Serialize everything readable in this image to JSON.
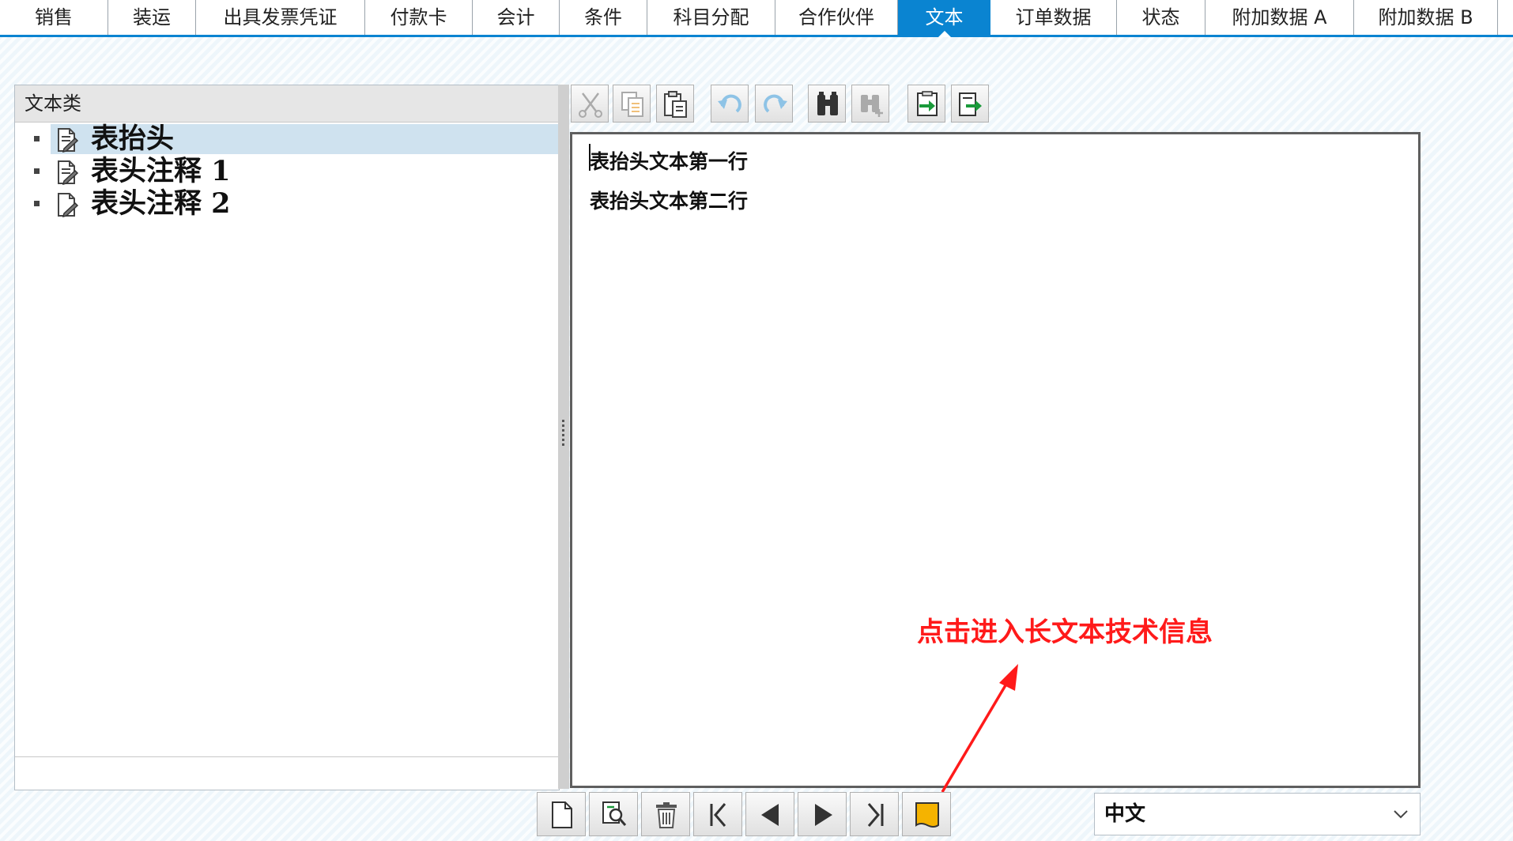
{
  "tabs": [
    {
      "label": "销售",
      "active": false
    },
    {
      "label": "装运",
      "active": false
    },
    {
      "label": "出具发票凭证",
      "active": false
    },
    {
      "label": "付款卡",
      "active": false
    },
    {
      "label": "会计",
      "active": false
    },
    {
      "label": "条件",
      "active": false
    },
    {
      "label": "科目分配",
      "active": false
    },
    {
      "label": "合作伙伴",
      "active": false
    },
    {
      "label": "文本",
      "active": true
    },
    {
      "label": "订单数据",
      "active": false
    },
    {
      "label": "状态",
      "active": false
    },
    {
      "label": "附加数据 A",
      "active": false
    },
    {
      "label": "附加数据 B",
      "active": false
    }
  ],
  "left_panel": {
    "header": "文本类",
    "items": [
      {
        "label": "表抬头",
        "selected": true,
        "icon": "document-edit-icon"
      },
      {
        "label": "表头注释 1",
        "selected": false,
        "icon": "document-edit-icon"
      },
      {
        "label": "表头注释 2",
        "selected": false,
        "icon": "document-edit-icon"
      }
    ]
  },
  "toolbar": {
    "buttons": [
      {
        "icon": "cut-icon",
        "enabled": false
      },
      {
        "icon": "copy-icon",
        "enabled": false
      },
      {
        "icon": "paste-icon",
        "enabled": true
      },
      {
        "icon": "undo-icon",
        "enabled": false
      },
      {
        "icon": "redo-icon",
        "enabled": false
      },
      {
        "icon": "find-icon",
        "enabled": true
      },
      {
        "icon": "find-next-icon",
        "enabled": false
      },
      {
        "icon": "import-icon",
        "enabled": true
      },
      {
        "icon": "export-icon",
        "enabled": true
      }
    ]
  },
  "editor": {
    "lines": [
      "表抬头文本第一行",
      "表抬头文本第二行"
    ]
  },
  "annotation": {
    "text": "点击进入长文本技术信息",
    "color": "#ff1a1a"
  },
  "bottom_toolbar": {
    "buttons": [
      {
        "icon": "new-document-icon"
      },
      {
        "icon": "search-document-icon"
      },
      {
        "icon": "delete-icon"
      },
      {
        "icon": "first-icon"
      },
      {
        "icon": "previous-icon"
      },
      {
        "icon": "next-icon"
      },
      {
        "icon": "last-icon"
      },
      {
        "icon": "long-text-icon"
      }
    ]
  },
  "language": {
    "selected": "中文"
  },
  "colors": {
    "accent": "#0a84d1",
    "highlight": "#cfe2ef"
  }
}
